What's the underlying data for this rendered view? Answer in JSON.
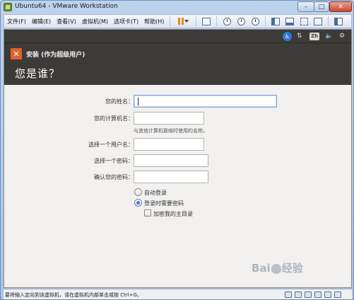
{
  "window": {
    "title": "Ubuntu64 - VMware Workstation",
    "controls": {
      "minimize": "–",
      "maximize": "□",
      "close": "✕"
    }
  },
  "menubar": {
    "items": [
      {
        "label": "文件(F)"
      },
      {
        "label": "编辑(E)"
      },
      {
        "label": "查看(V)"
      },
      {
        "label": "虚拟机(M)"
      },
      {
        "label": "选项卡(T)"
      },
      {
        "label": "帮助(H)"
      }
    ],
    "toolbar_icons": [
      "pause-icon",
      "send-ctrl-alt-del-icon",
      "snapshot-icon",
      "revert-snapshot-icon",
      "snapshot-manager-icon",
      "show-library-icon",
      "thumbnail-bar-icon",
      "full-screen-icon",
      "unity-icon",
      "console-view-icon"
    ]
  },
  "guest_panel": {
    "icons": [
      "accessibility-icon",
      "network-icon",
      "input-method-icon",
      "volume-icon",
      "settings-gear-icon"
    ],
    "input_method_label": "Zh"
  },
  "installer": {
    "window_title": "安装 (作为超级用户)",
    "close_symbol": "✕",
    "heading": "您是谁？",
    "fields": {
      "name_label": "您的姓名：",
      "name_value": "",
      "computer_label": "您的计算机名：",
      "computer_value": "",
      "computer_hint": "与其他计算机联络时使用的名称。",
      "username_label": "选择一个用户名：",
      "username_value": "",
      "password_label": "选择一个密码：",
      "password_value": "",
      "confirm_label": "确认您的密码：",
      "confirm_value": ""
    },
    "login_options": {
      "auto_login": "自动登录",
      "require_password": "登录时需要密码",
      "selected": "require_password",
      "encrypt_home": "加密我的主目录",
      "encrypt_home_checked": false
    }
  },
  "watermark": {
    "text_left": "Bai",
    "text_right": "经验"
  },
  "statusbar": {
    "text": "要将输入定向到该虚拟机，请在虚拟机内部单击或按 Ctrl+G。"
  }
}
